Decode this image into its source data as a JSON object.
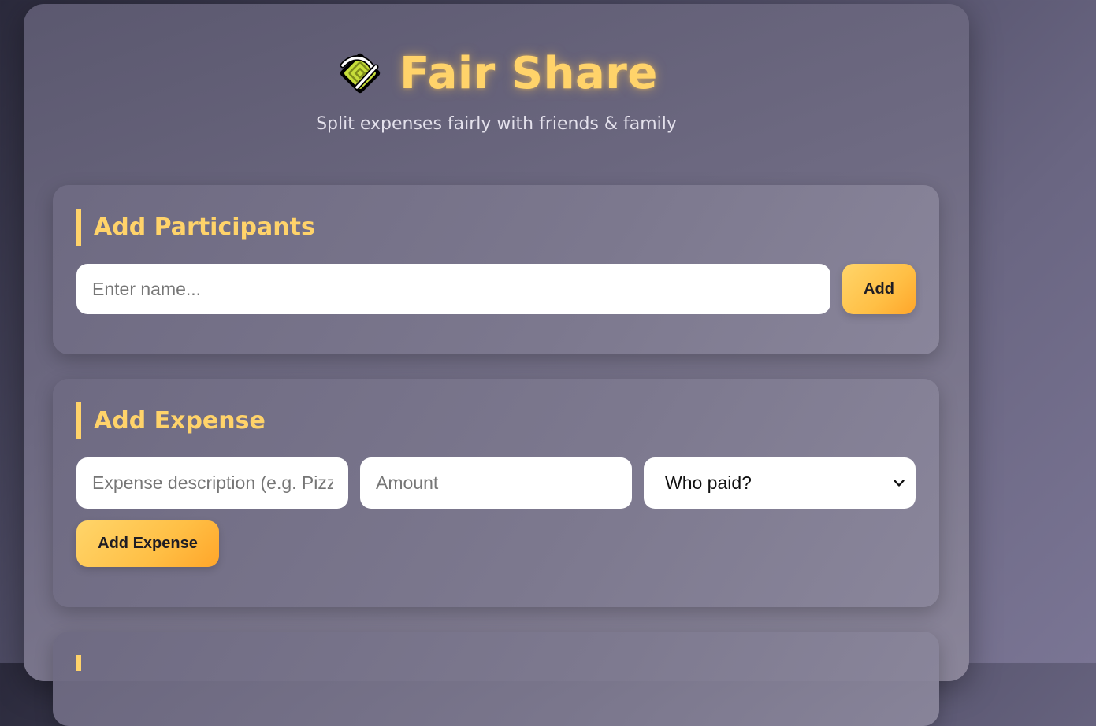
{
  "app": {
    "title": "Fair Share",
    "subtitle": "Split expenses fairly with friends & family",
    "logo_icon": "split-arrows-logo-icon",
    "accent_color": "#ffd36a",
    "button_gradient": [
      "#ffd56a",
      "#ffa62a"
    ]
  },
  "participants": {
    "heading": "Add Participants",
    "name_placeholder": "Enter name...",
    "name_value": "",
    "add_label": "Add"
  },
  "expense": {
    "heading": "Add Expense",
    "description_placeholder": "Expense description (e.g. Pizza)",
    "amount_placeholder": "Amount",
    "payer_selected": "Who paid?",
    "payer_icon": "chevron-down-icon",
    "add_label": "Add Expense"
  }
}
